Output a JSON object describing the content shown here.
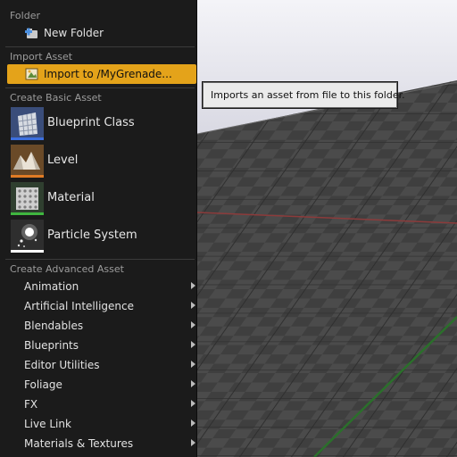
{
  "menu": {
    "folder_header": "Folder",
    "new_folder": {
      "label": "New Folder",
      "icon": "new-folder-icon"
    },
    "import_header": "Import Asset",
    "import_item": {
      "label": "Import to /MyGrenade...",
      "icon": "import-icon",
      "highlight_color": "#e4a31a"
    },
    "basic_header": "Create Basic Asset",
    "basic_assets": [
      {
        "label": "Blueprint Class",
        "icon": "blueprint-class-icon",
        "accent": "#3c6fe0"
      },
      {
        "label": "Level",
        "icon": "level-icon",
        "accent": "#e07b25"
      },
      {
        "label": "Material",
        "icon": "material-icon",
        "accent": "#3fb63f"
      },
      {
        "label": "Particle System",
        "icon": "particle-system-icon",
        "accent": "#ffffff"
      }
    ],
    "advanced_header": "Create Advanced Asset",
    "advanced_items": [
      {
        "label": "Animation"
      },
      {
        "label": "Artificial Intelligence"
      },
      {
        "label": "Blendables"
      },
      {
        "label": "Blueprints"
      },
      {
        "label": "Editor Utilities"
      },
      {
        "label": "Foliage"
      },
      {
        "label": "FX"
      },
      {
        "label": "Live Link"
      },
      {
        "label": "Materials & Textures"
      }
    ]
  },
  "tooltip": {
    "text": "Imports an asset from file to this folder."
  }
}
